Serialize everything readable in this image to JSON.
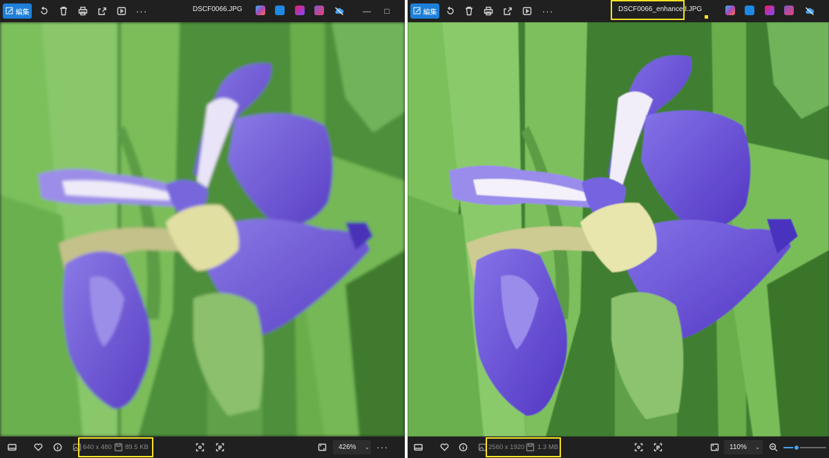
{
  "left": {
    "toolbar": {
      "edit_label": "編集",
      "filename": "DSCF0066.JPG"
    },
    "status": {
      "dimensions": "640 x 480",
      "file_size": "89.5 KB",
      "zoom": "426%"
    }
  },
  "right": {
    "toolbar": {
      "edit_label": "編集",
      "filename": "DSCF0066_enhanced.JPG"
    },
    "status": {
      "dimensions": "2560 x 1920",
      "file_size": "1.3 MB",
      "zoom": "110%",
      "zoom_slider_level": 0.3
    }
  },
  "icons": [
    "edit-icon",
    "rotate-icon",
    "delete-icon",
    "print-icon",
    "share-icon",
    "slideshow-icon",
    "more-icon",
    "copilot-icon",
    "designer-icon",
    "clipchamp-icon",
    "onedrive-sync-off-icon",
    "minimize-icon",
    "maximize-icon",
    "filmstrip-icon",
    "favorite-icon",
    "info-icon",
    "image-icon",
    "save-icon",
    "crop-icon",
    "ocr-icon",
    "fit-window-icon",
    "zoom-out-icon"
  ],
  "colors": {
    "highlight": "#f7e425",
    "accent": "#1e7fd8",
    "toolbar_bg": "#202020",
    "iris_purple": "#6a4fcf",
    "leaf_green": "#6bb04a"
  }
}
